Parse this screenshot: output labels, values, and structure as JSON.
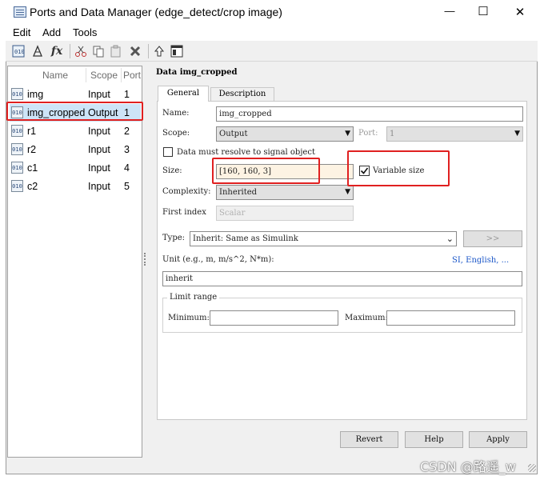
{
  "window": {
    "title": "Ports and Data Manager (edge_detect/crop image)",
    "controls": {
      "minimize": "—",
      "maximize": "☐",
      "close": "✕"
    }
  },
  "menu": [
    "Edit",
    "Add",
    "Tools"
  ],
  "toolbar": {
    "fx_label": "fx",
    "icons": [
      "add-data-icon",
      "add-port-icon",
      "fx-icon",
      "cut-icon",
      "copy-icon",
      "paste-icon",
      "delete-icon",
      "up-arrow-icon",
      "model-explorer-icon"
    ]
  },
  "list": {
    "headers": {
      "name": "Name",
      "scope": "Scope",
      "port": "Port"
    },
    "rows": [
      {
        "name": "img",
        "scope": "Input",
        "port": "1"
      },
      {
        "name": "img_cropped",
        "scope": "Output",
        "port": "1"
      },
      {
        "name": "r1",
        "scope": "Input",
        "port": "2"
      },
      {
        "name": "r2",
        "scope": "Input",
        "port": "3"
      },
      {
        "name": "c1",
        "scope": "Input",
        "port": "4"
      },
      {
        "name": "c2",
        "scope": "Input",
        "port": "5"
      }
    ],
    "selected_index": 1,
    "icon_text": "010"
  },
  "detail": {
    "heading": "Data img_cropped",
    "tabs": {
      "general": "General",
      "description": "Description"
    },
    "name_label": "Name:",
    "name_value": "img_cropped",
    "scope_label": "Scope:",
    "scope_value": "Output",
    "port_label": "Port:",
    "port_value": "1",
    "must_resolve_label": "Data must resolve to signal object",
    "size_label": "Size:",
    "size_value": "[160, 160, 3]",
    "variable_size_label": "Variable size",
    "variable_size_checked": true,
    "complexity_label": "Complexity:",
    "complexity_value": "Inherited",
    "first_index_label": "First index",
    "first_index_placeholder": "Scalar",
    "type_label": "Type:",
    "type_value": "Inherit: Same as Simulink",
    "type_button": ">>",
    "unit_label": "Unit (e.g., m, m/s^2, N*m):",
    "unit_link": "SI, English, ...",
    "unit_value": "inherit",
    "limit_range_label": "Limit range",
    "minimum_label": "Minimum:",
    "maximum_label": "Maximum:",
    "minimum_value": "",
    "maximum_value": ""
  },
  "buttons": {
    "revert": "Revert",
    "help": "Help",
    "apply": "Apply"
  },
  "watermark": "CSDN @路遥_w",
  "colors": {
    "highlight_red": "#e02020",
    "size_field_bg": "#fdf3e3",
    "selected_row": "#cde4f7",
    "link_blue": "#1a56c8"
  }
}
